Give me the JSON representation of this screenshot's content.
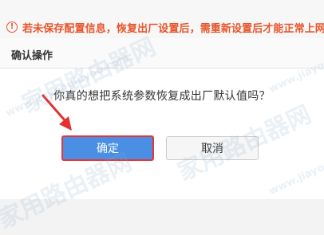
{
  "warning": {
    "icon": "info-icon",
    "text": "若未保存配置信息，恢复出厂设置后，需重新设置后才能正常上网！"
  },
  "dialog": {
    "title": "确认操作",
    "message": "你真的想把系统参数恢复成出厂默认值吗？",
    "confirm_label": "确定",
    "cancel_label": "取消"
  },
  "watermark": {
    "url": "www.jiayongluyou.com",
    "text": "家用路由器网"
  },
  "colors": {
    "accent": "#4a8fe3",
    "warning": "#e8552c",
    "highlight": "#ea3434"
  }
}
